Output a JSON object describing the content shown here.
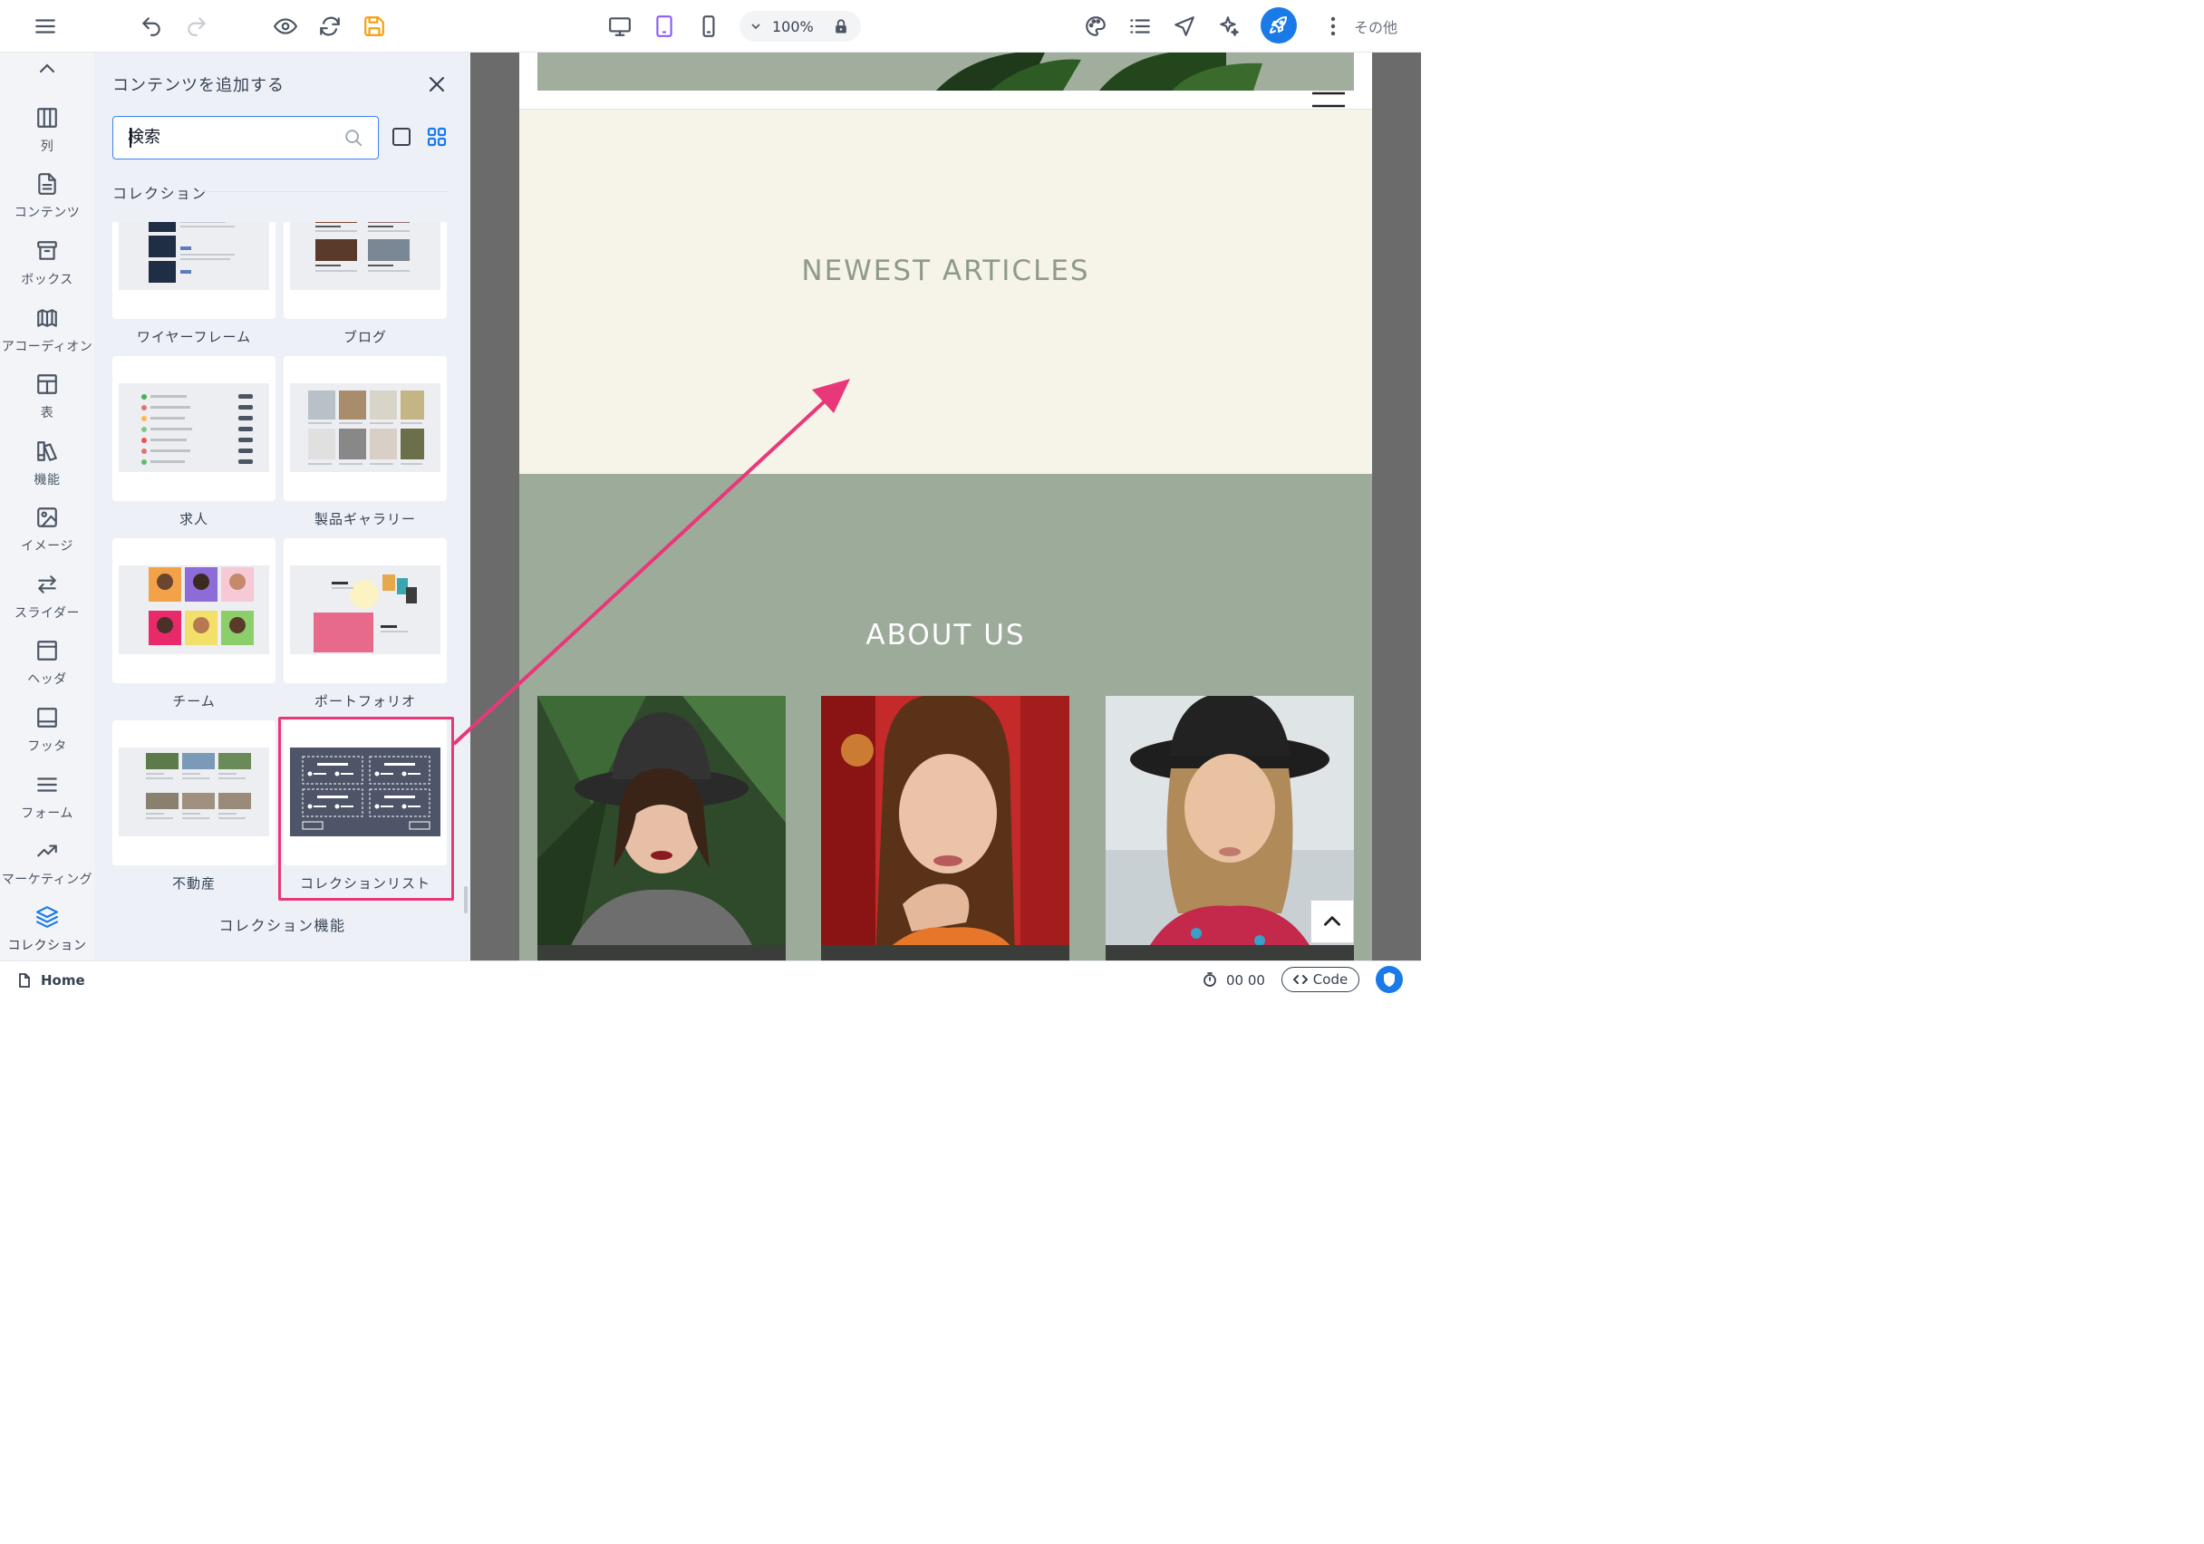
{
  "toolbar": {
    "zoom": "100%",
    "more_label": "その他"
  },
  "rail": {
    "items": [
      {
        "label": "列"
      },
      {
        "label": "コンテンツ"
      },
      {
        "label": "ボックス"
      },
      {
        "label": "アコーディオン"
      },
      {
        "label": "表"
      },
      {
        "label": "機能"
      },
      {
        "label": "イメージ"
      },
      {
        "label": "スライダー"
      },
      {
        "label": "ヘッダ"
      },
      {
        "label": "フッタ"
      },
      {
        "label": "フォーム"
      },
      {
        "label": "マーケティング"
      },
      {
        "label": "コレクション"
      }
    ]
  },
  "panel": {
    "title": "コンテンツを追加する",
    "search_placeholder": "検索",
    "section_label": "コレクション",
    "cards": [
      {
        "label": "ワイヤーフレーム"
      },
      {
        "label": "ブログ"
      },
      {
        "label": "求人"
      },
      {
        "label": "製品ギャラリー"
      },
      {
        "label": "チーム"
      },
      {
        "label": "ポートフォリオ"
      },
      {
        "label": "不動産"
      },
      {
        "label": "コレクションリスト"
      }
    ],
    "feature_label": "コレクション機能"
  },
  "canvas": {
    "articles_heading": "NEWEST ARTICLES",
    "about_heading": "ABOUT US"
  },
  "status": {
    "page": "Home",
    "timer": "00 00",
    "code_label": "Code"
  },
  "colors": {
    "accent": "#1a7ae8",
    "highlight": "#e8387a",
    "sage": "#9dab9b",
    "cream": "#f6f3e9"
  }
}
